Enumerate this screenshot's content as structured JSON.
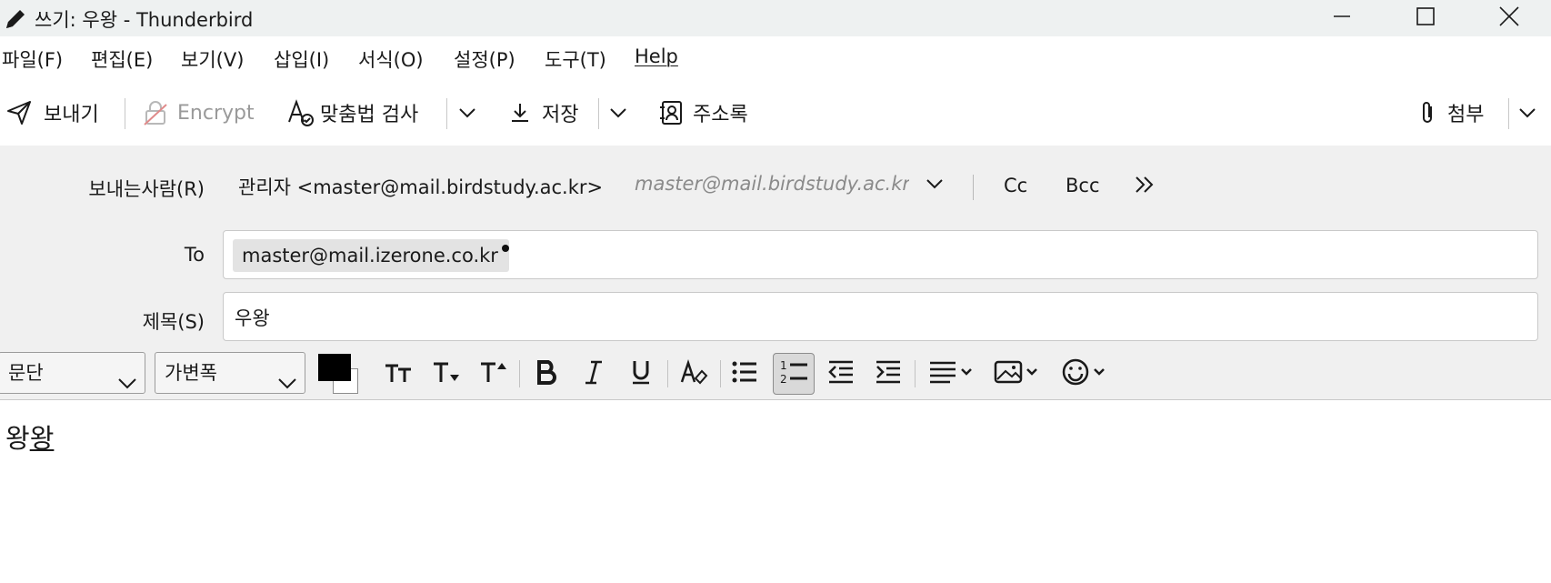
{
  "window": {
    "title": "쓰기: 우왕 - Thunderbird",
    "icons": [
      "pencil-icon",
      "minimize-icon",
      "maximize-icon",
      "close-icon"
    ]
  },
  "menu": {
    "items": [
      "파일(F)",
      "편집(E)",
      "보기(V)",
      "삽입(I)",
      "서식(O)",
      "설정(P)",
      "도구(T)",
      "Help"
    ]
  },
  "toolbar": {
    "send_label": "보내기",
    "encrypt_label": "Encrypt",
    "spellcheck_label": "맞춤법 검사",
    "save_label": "저장",
    "addressbook_label": "주소록",
    "attach_label": "첨부"
  },
  "header": {
    "from_label": "보내는사람(R)",
    "from_value": "관리자 <master@mail.birdstudy.ac.kr>",
    "from_identity": "master@mail.birdstudy.ac.kr",
    "cc_label": "Cc",
    "bcc_label": "Bcc",
    "more_label": "»",
    "to_label": "To",
    "to_recipient": "master@mail.izerone.co.kr",
    "subject_label": "제목(S)",
    "subject_value": "우왕"
  },
  "format": {
    "paragraph_value": "문단",
    "font_value": "가변폭",
    "text_color": "#000000",
    "bg_color": "#ffffff"
  },
  "body": {
    "text_plain": "왕",
    "text_underlined": "왕"
  }
}
